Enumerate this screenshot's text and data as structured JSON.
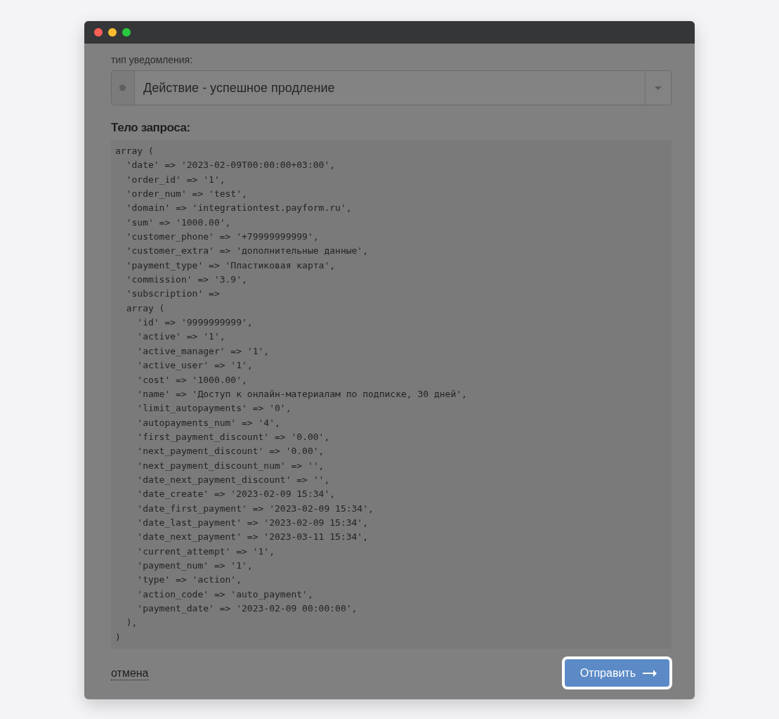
{
  "window": {
    "controls": [
      {
        "color": "#fe5f57"
      },
      {
        "color": "#febc2e"
      },
      {
        "color": "#28c840"
      }
    ]
  },
  "notification_type": {
    "label": "тип уведомления:",
    "value": "Действие - успешное продление"
  },
  "request_body": {
    "heading": "Тело запроса:",
    "code": "array (\n  'date' => '2023-02-09T00:00:00+03:00',\n  'order_id' => '1',\n  'order_num' => 'test',\n  'domain' => 'integrationtest.payform.ru',\n  'sum' => '1000.00',\n  'customer_phone' => '+79999999999',\n  'customer_extra' => 'дополнительные данные',\n  'payment_type' => 'Пластиковая карта',\n  'commission' => '3.9',\n  'subscription' => \n  array (\n    'id' => '9999999999',\n    'active' => '1',\n    'active_manager' => '1',\n    'active_user' => '1',\n    'cost' => '1000.00',\n    'name' => 'Доступ к онлайн-материалам по подписке, 30 дней',\n    'limit_autopayments' => '0',\n    'autopayments_num' => '4',\n    'first_payment_discount' => '0.00',\n    'next_payment_discount' => '0.00',\n    'next_payment_discount_num' => '',\n    'date_next_payment_discount' => '',\n    'date_create' => '2023-02-09 15:34',\n    'date_first_payment' => '2023-02-09 15:34',\n    'date_last_payment' => '2023-02-09 15:34',\n    'date_next_payment' => '2023-03-11 15:34',\n    'current_attempt' => '1',\n    'payment_num' => '1',\n    'type' => 'action',\n    'action_code' => 'auto_payment',\n    'payment_date' => '2023-02-09 00:00:00',\n  ),\n)"
  },
  "footer": {
    "cancel": "отмена",
    "submit": {
      "label": "Отправить",
      "highlighted": true
    }
  }
}
